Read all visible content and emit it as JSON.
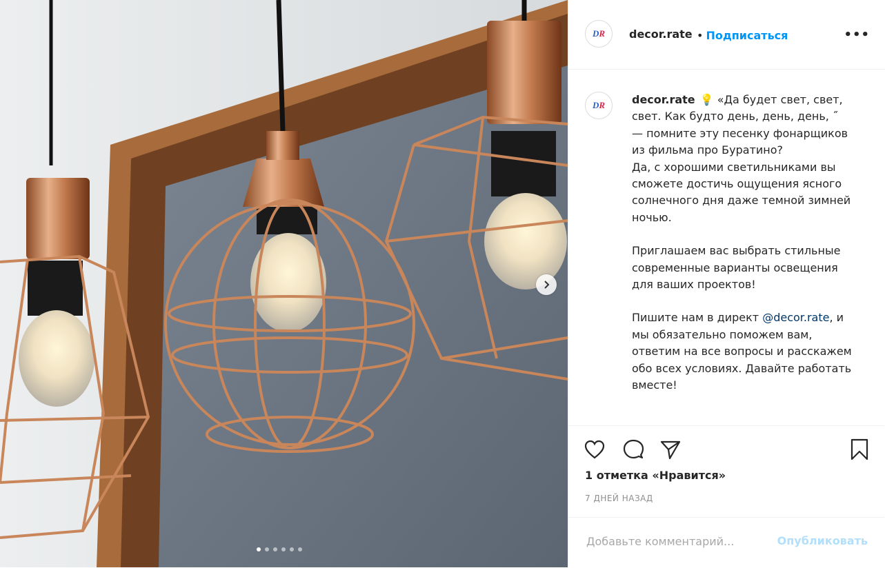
{
  "post": {
    "username": "decor.rate",
    "follow_label": "Подписаться",
    "follow_separator": "•",
    "more_label": "•••",
    "avatar_text_1": "DR",
    "caption_lead": "💡 «Да будет свет, свет, свет. Как будто день, день, день, ˝ — помните эту песенку фонарщиков из фильма про Буратино?",
    "caption_p1_rest": "Да, с хорошими светильниками вы сможете достичь ощущения ясного солнечного дня даже темной зимней ночью.",
    "caption_p2": "Приглашаем вас выбрать стильные современные варианты освещения для ваших проектов!",
    "caption_p3_before": "Пишите нам в директ ",
    "caption_p3_mention": "@decor.rate",
    "caption_p3_after": ", и мы обязательно поможем вам, ответим на все вопросы и расскажем обо всех условиях. Давайте работать вместе!",
    "likes": "1 отметка «Нравится»",
    "time": "7 дней назад"
  },
  "comment": {
    "placeholder": "Добавьте комментарий...",
    "publish_label": "Опубликовать"
  },
  "carousel": {
    "slide_count": 6,
    "active_index": 0
  },
  "icons": [
    "heart-icon",
    "comment-icon",
    "share-icon",
    "bookmark-icon",
    "chevron-right-icon",
    "more-icon"
  ],
  "colors": {
    "link_blue": "#0095f6",
    "publish_disabled": "#b2dffc",
    "copper": "#c8865a",
    "mention": "#00376b"
  }
}
